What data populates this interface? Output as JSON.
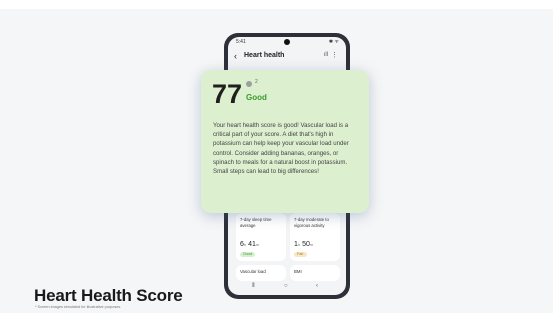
{
  "phone": {
    "status_time": "5:41",
    "status_icons": "✱ ᯤ",
    "title": "Heart health",
    "chart_icon": "ıll",
    "more_icon": "⋮"
  },
  "overlay": {
    "score": "77",
    "info_number": "2",
    "grade": "Good",
    "description": "Your heart health score is good! Vascular load is a critical part of your score. A diet that's high in potassium can help keep your vascular load under control. Consider adding bananas, oranges, or spinach to meals for a natural boost in potassium. Small steps can lead to big differences!",
    "accent_color": "#3c9a2e",
    "background_color": "#dcefcf"
  },
  "cards": {
    "sleep": {
      "title": "7-day sleep time average",
      "value_hours": "6",
      "unit_h": "h",
      "value_minutes": "41",
      "unit_m": "m",
      "badge": "Good"
    },
    "activity": {
      "title": "7-day moderate to vigorous activity",
      "value_hours": "1",
      "unit_h": "h",
      "value_minutes": "50",
      "unit_m": "m",
      "badge": "Fair"
    },
    "vascular": {
      "title": "Vascular load"
    },
    "bmi": {
      "title": "BMI"
    }
  },
  "navbar": {
    "recents_icon": "⦀",
    "home_icon": "○",
    "back_icon": "‹"
  },
  "footer": {
    "title": "Heart Health Score",
    "disclaimer": "* Screen images simulated for illustrative purposes."
  }
}
